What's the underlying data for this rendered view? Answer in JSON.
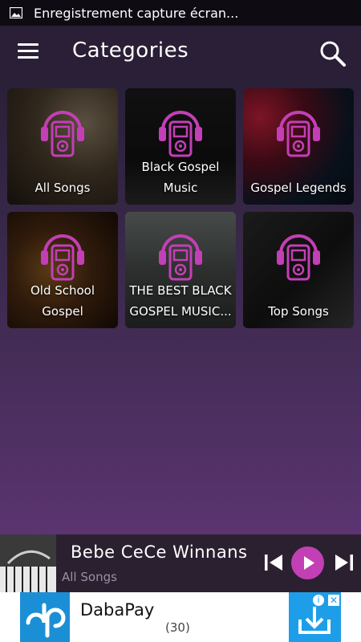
{
  "statusbar": {
    "notification_text": "Enregistrement capture écran..."
  },
  "appbar": {
    "title": "Categories"
  },
  "categories": [
    {
      "label": "All Songs"
    },
    {
      "label": "Black Gospel Music"
    },
    {
      "label": "Gospel Legends"
    },
    {
      "label": "Old School Gospel"
    },
    {
      "label": "THE BEST BLACK GOSPEL MUSIC..."
    },
    {
      "label": "Top Songs"
    }
  ],
  "player": {
    "track_title": "Bebe  CeCe Winnans",
    "source": "All Songs"
  },
  "ad": {
    "name": "DabaPay",
    "count": "(30)",
    "logo_text": "dp",
    "info_glyph": "i",
    "close_glyph": "✕"
  },
  "colors": {
    "accent": "#c33fb5",
    "appbar": "#2a1f36",
    "ad_blue": "#1e9ee8"
  }
}
